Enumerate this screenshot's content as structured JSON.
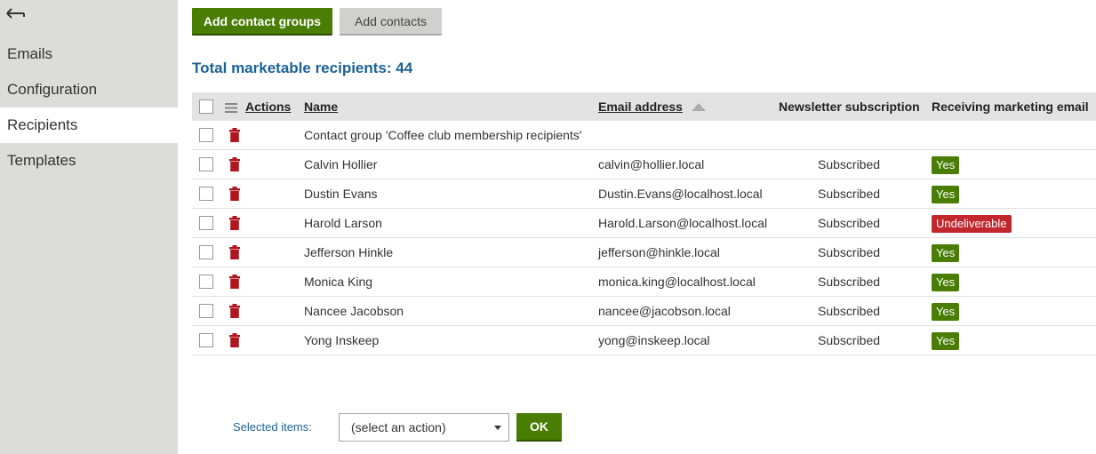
{
  "sidebar": {
    "items": [
      {
        "label": "Emails"
      },
      {
        "label": "Configuration"
      },
      {
        "label": "Recipients"
      },
      {
        "label": "Templates"
      }
    ]
  },
  "toolbar": {
    "add_groups_label": "Add contact groups",
    "add_contacts_label": "Add contacts"
  },
  "summary": {
    "total_label": "Total marketable recipients: 44"
  },
  "grid": {
    "headers": {
      "actions": "Actions",
      "name": "Name",
      "email": "Email address",
      "subscription": "Newsletter subscription",
      "receiving": "Receiving marketing email"
    },
    "rows": [
      {
        "name": "Contact group 'Coffee club membership recipients'",
        "email": "",
        "subscription": "",
        "status": ""
      },
      {
        "name": "Calvin Hollier",
        "email": "calvin@hollier.local",
        "subscription": "Subscribed",
        "status": "Yes"
      },
      {
        "name": "Dustin Evans",
        "email": "Dustin.Evans@localhost.local",
        "subscription": "Subscribed",
        "status": "Yes"
      },
      {
        "name": "Harold Larson",
        "email": "Harold.Larson@localhost.local",
        "subscription": "Subscribed",
        "status": "Undeliverable"
      },
      {
        "name": "Jefferson Hinkle",
        "email": "jefferson@hinkle.local",
        "subscription": "Subscribed",
        "status": "Yes"
      },
      {
        "name": "Monica King",
        "email": "monica.king@localhost.local",
        "subscription": "Subscribed",
        "status": "Yes"
      },
      {
        "name": "Nancee Jacobson",
        "email": "nancee@jacobson.local",
        "subscription": "Subscribed",
        "status": "Yes"
      },
      {
        "name": "Yong Inskeep",
        "email": "yong@inskeep.local",
        "subscription": "Subscribed",
        "status": "Yes"
      }
    ]
  },
  "footer": {
    "selected_label": "Selected items:",
    "action_select": "(select an action)",
    "ok_label": "OK"
  },
  "colors": {
    "primary": "#497d04",
    "link_blue": "#1c6296",
    "trash": "#b0161d",
    "badge_yes": "#497d04",
    "badge_undeliverable": "#c1272d"
  },
  "icons": {
    "back": "back-arrow-icon",
    "trash": "trash-icon",
    "menu": "menu-icon",
    "sort": "sort-ascending-icon"
  }
}
